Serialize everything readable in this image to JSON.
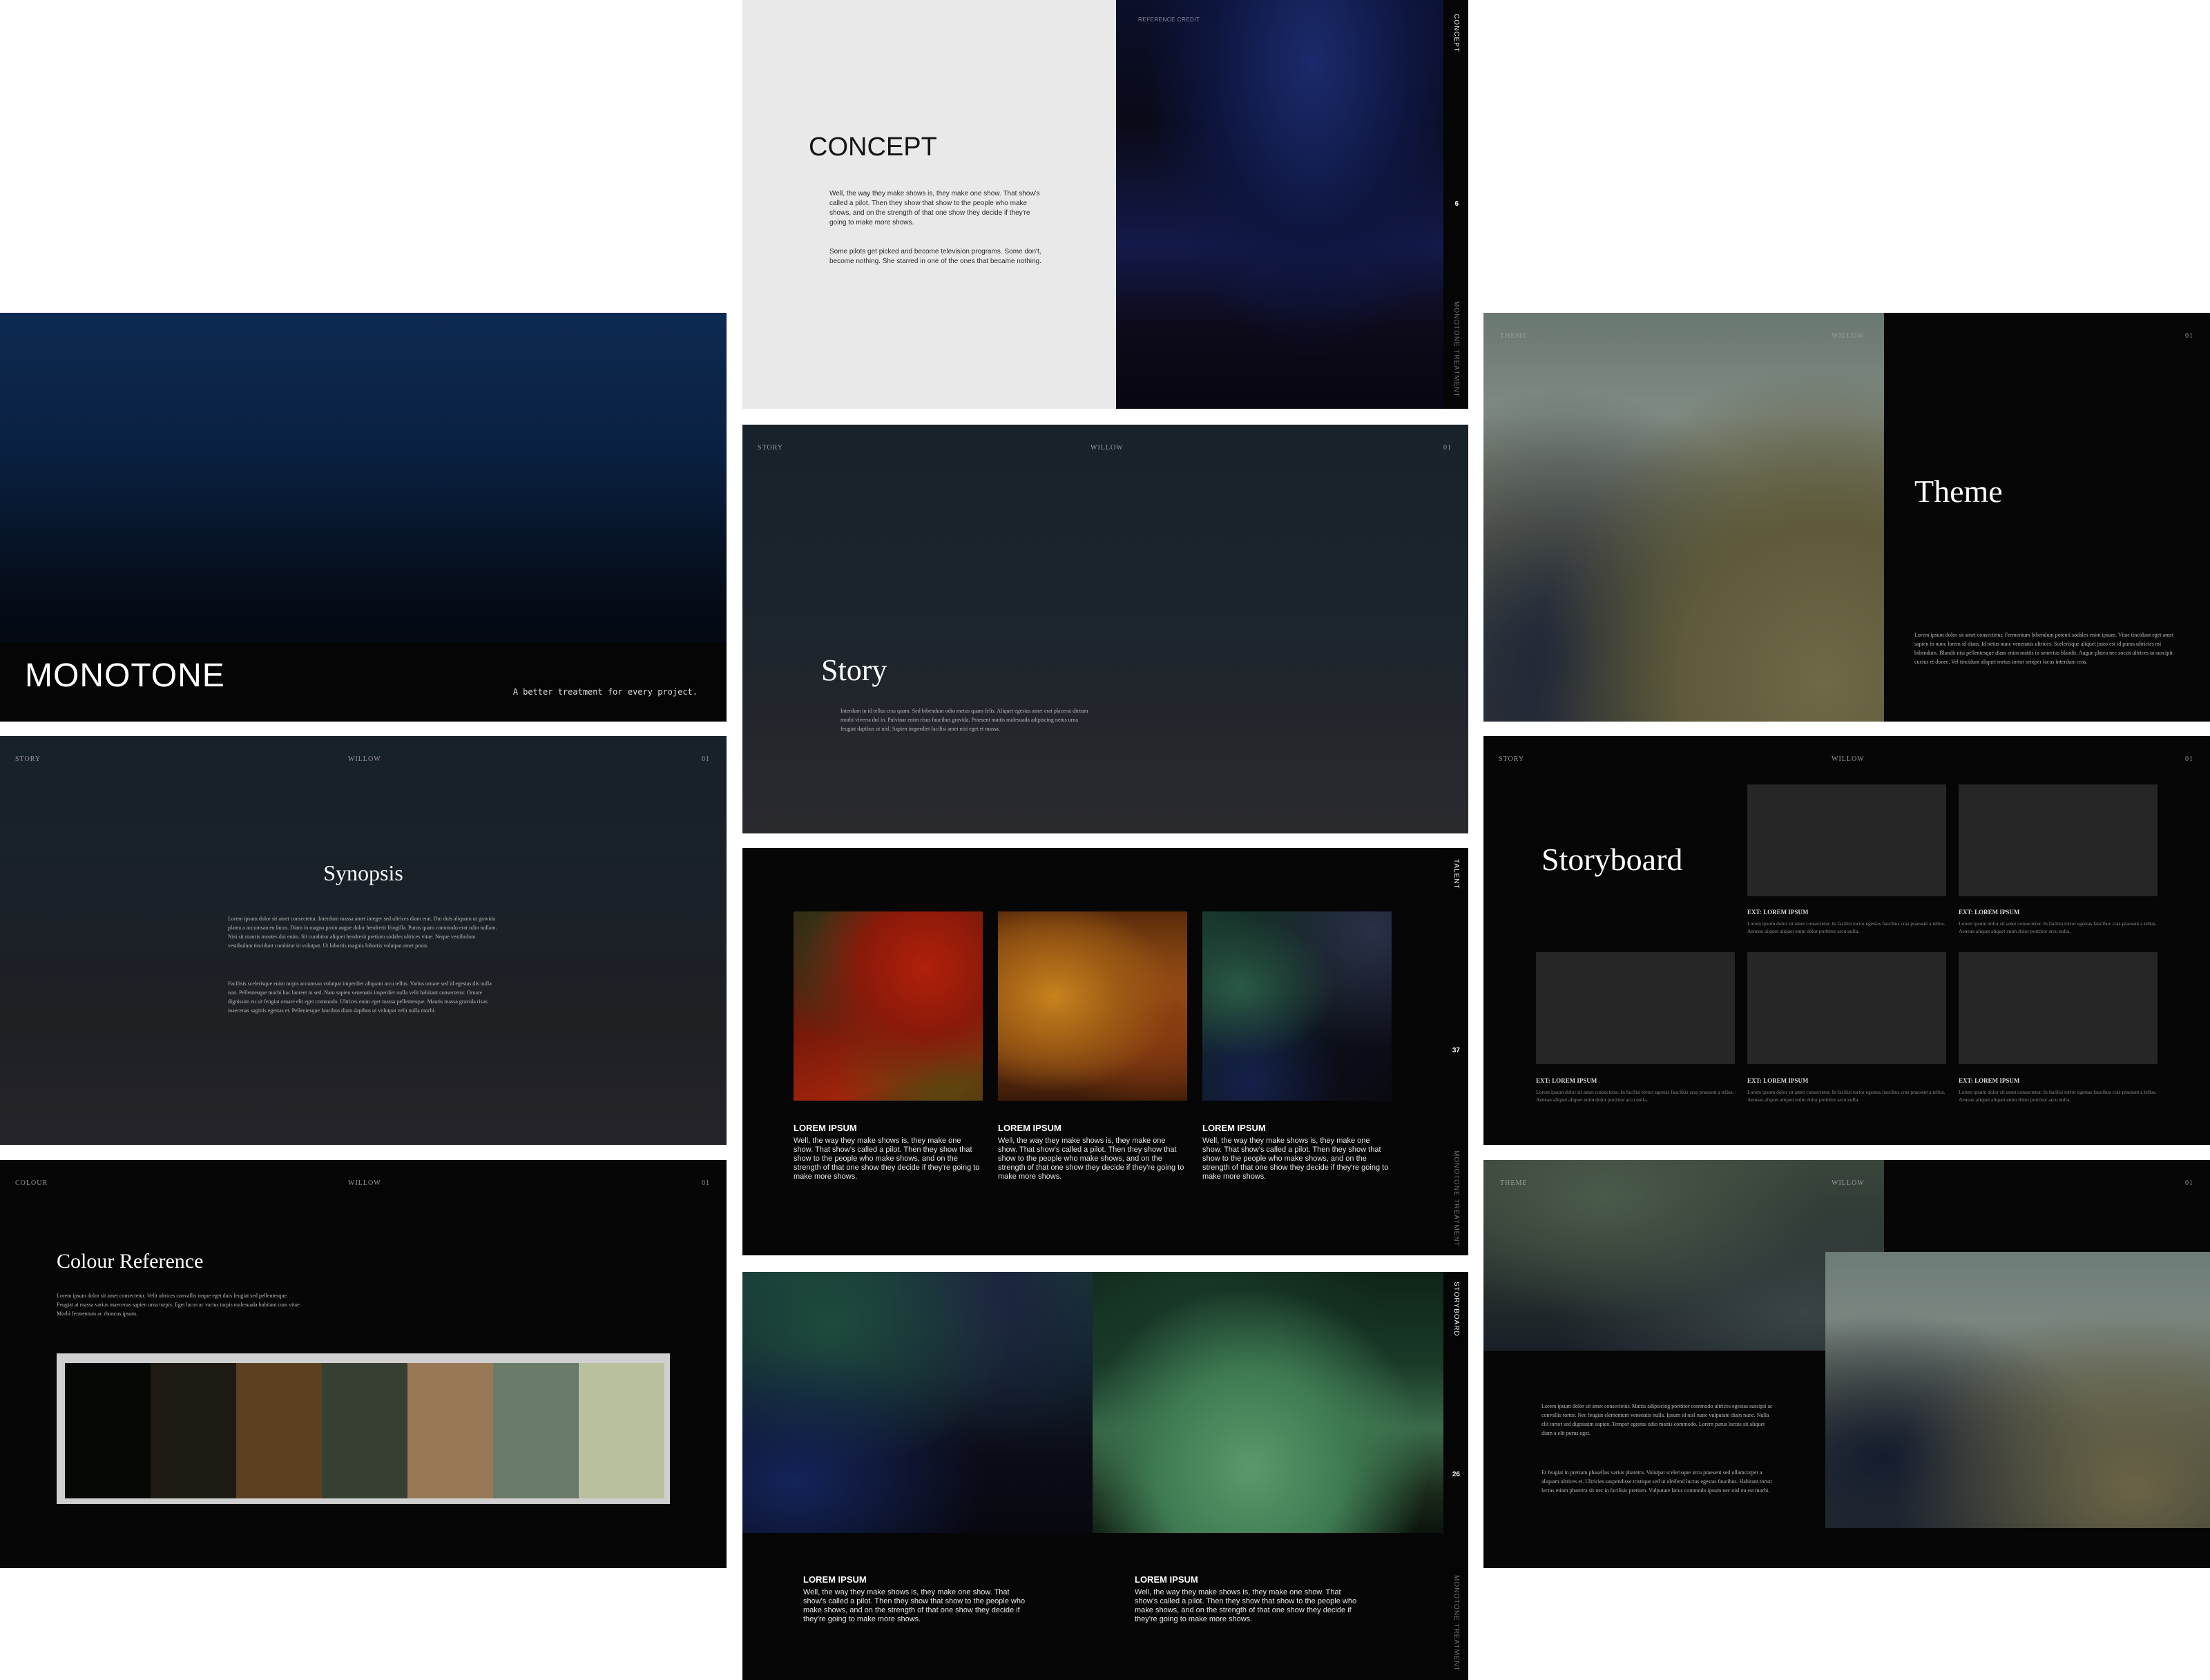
{
  "cover": {
    "title": "MONOTONE",
    "tagline": "A better treatment for every project."
  },
  "concept": {
    "title": "CONCEPT",
    "paragraph1": "Well, the way they make shows is, they make one show. That show's called a pilot. Then they show that show to the people who make shows, and on the strength of that one show they decide if they're going to make more shows.",
    "paragraph2": "Some pilots get picked and become television programs. Some don't, become nothing. She starred in one of the ones that became nothing.",
    "reference_credit": "REFERENCE CREDIT",
    "side_label": "CONCEPT",
    "page_number": "6",
    "side_footer": "MONOTONE TREATMENT"
  },
  "theme1": {
    "section": "THEME",
    "project": "WILLOW",
    "page": "01",
    "title": "Theme",
    "body": "Lorem ipsum dolor sit amet consectetur. Fermentum bibendum potenti sodales enim ipsum. Vitae tincidunt eget amet sapien in nunc lorem id diam. Id netus nunc venenatis ultrices. Scelerisque aliquet justo est id purus ultricies mi bibendum. Blandit nisi pellentesque diam enim mattis in senectus blandit. Augue platea nec sociis ultrices ut suscipit cursus et donec. Vel tincidunt aliquet metus tortor semper lacus interdum cras."
  },
  "story": {
    "section": "STORY",
    "project": "WILLOW",
    "page": "01",
    "title": "Story",
    "body": "Interdum in id tellus cras quam. Sed bibendum odio metus quam felis. Aliquet egestas amet erat placerat dictum morbi viverra dui in. Pulvinar enim risus faucibus gravida. Praesent mattis malesuada adipiscing netus urna feugiat dapibus ut nisl. Sapien imperdiet facilisi amet nisi eget et massa."
  },
  "synopsis": {
    "section": "STORY",
    "project": "WILLOW",
    "page": "01",
    "title": "Synopsis",
    "paragraph1": "Lorem ipsum dolor sit amet consectetur. Interdum massa amet integer sed ultrices diam erat. Dui duis aliquam ut gravida platea a accumsan eu lacus. Diam in magna proin augue dolor hendrerit fringilla. Purus quam commodo erat odio nullam. Nisi sit mauris montes dui enim. Sit curabitur aliquet hendrerit pretium sodales ultrices vitae. Neque vestibulum vestibulum tincidunt curabitur in volutpat. Ut lobortis magnis lobortis volutpat amet proin.",
    "paragraph2": "Facilisis scelerisque enim turpis accumsan volutpat imperdiet aliquam arcu tellus. Varius ornare sed id egestas dis nulla non. Pellentesque morbi hac laoreet in sed. Nam sapien venenatis imperdiet nulla velit habitant consectetur. Ornare dignissim eu sit feugiat ornare elit eget commodo. Ultrices enim eget massa pellentesque. Mauris massa gravida risus maecenas sagittis egestas et. Pellentesque faucibus diam dapibus ut volutpat velit nulla morbi."
  },
  "storyboard": {
    "section": "STORY",
    "project": "WILLOW",
    "page": "01",
    "title": "Storyboard",
    "frames": [
      {
        "caption": "EXT: LOREM IPSUM",
        "text": "Lorem ipsum dolor sit amet consectetur. In facilisi tortor egestas faucibus cras praesent a tellus. Aenean aliquet aliquet enim dolor porttitor arcu nulla."
      },
      {
        "caption": "EXT: LOREM IPSUM",
        "text": "Lorem ipsum dolor sit amet consectetur. In facilisi tortor egestas faucibus cras praesent a tellus. Aenean aliquet aliquet enim dolor porttitor arcu nulla."
      },
      {
        "caption": "EXT: LOREM IPSUM",
        "text": "Lorem ipsum dolor sit amet consectetur. In facilisi tortor egestas faucibus cras praesent a tellus. Aenean aliquet aliquet enim dolor porttitor arcu nulla."
      },
      {
        "caption": "EXT: LOREM IPSUM",
        "text": "Lorem ipsum dolor sit amet consectetur. In facilisi tortor egestas faucibus cras praesent a tellus. Aenean aliquet aliquet enim dolor porttitor arcu nulla."
      },
      {
        "caption": "EXT: LOREM IPSUM",
        "text": "Lorem ipsum dolor sit amet consectetur. In facilisi tortor egestas faucibus cras praesent a tellus. Aenean aliquet aliquet enim dolor porttitor arcu nulla."
      }
    ]
  },
  "talent": {
    "side_label": "TALENT",
    "page_number": "37",
    "side_footer": "MONOTONE TREATMENT",
    "cards": [
      {
        "title": "LOREM IPSUM",
        "text": "Well, the way they make shows is, they make one show. That show's called a pilot. Then they show that show to the people who make shows, and on the strength of that one show they decide if they're going to make more shows."
      },
      {
        "title": "LOREM IPSUM",
        "text": "Well, the way they make shows is, they make one show. That show's called a pilot. Then they show that show to the people who make shows, and on the strength of that one show they decide if they're going to make more shows."
      },
      {
        "title": "LOREM IPSUM",
        "text": "Well, the way they make shows is, they make one show. That show's called a pilot. Then they show that show to the people who make shows, and on the strength of that one show they decide if they're going to make more shows."
      }
    ]
  },
  "colour": {
    "section": "COLOUR",
    "project": "WILLOW",
    "page": "01",
    "title": "Colour Reference",
    "body": "Lorem ipsum dolor sit amet consectetur. Velit ultrices convallis neque eget duis feugiat sed pellentesque. Feugiat at massa varius maecenas sapien urna turpis. Eget lacus ac varius turpis malesuada habitant cum vitae. Morbi fermentum ac rhoncus ipsum.",
    "swatches": [
      "#050805",
      "#1e1a14",
      "#5b4021",
      "#363f32",
      "#997855",
      "#6a7a69",
      "#b8c09e"
    ]
  },
  "storyboard2": {
    "side_label": "STORYBOARD",
    "page_number": "26",
    "side_footer": "MONOTONE TREATMENT",
    "cards": [
      {
        "title": "LOREM IPSUM",
        "text": "Well, the way they make shows is, they make one show. That show's called a pilot. Then they show that show to the people who make shows, and on the strength of that one show they decide if they're going to make more shows."
      },
      {
        "title": "LOREM IPSUM",
        "text": "Well, the way they make shows is, they make one show. That show's called a pilot. Then they show that show to the people who make shows, and on the strength of that one show they decide if they're going to make more shows."
      }
    ]
  },
  "theme2": {
    "section": "THEME",
    "project": "WILLOW",
    "page": "01",
    "paragraph1": "Lorem ipsum dolor sit amet consectetur. Mattis adipiscing porttitor commodo ultrices egestas suscipit ac convallis tortor. Nec feugiat elementum venenatis nulla. Ipsum id nisl nunc vulputate diam nunc. Nulla elit tortor sed dignissim sapien. Tempor egestas odio mattis commodo. Lorem purus luctus sit aliquet diam a elit purus eget.",
    "paragraph2": "Et feugiat in pretium phasellus varius pharetra. Volutpat scelerisque arcu praesent sed ullamcorper a aliquam ultrices et. Ultricies suspendisse tristique sed ut eleifend luctus egestas faucibus. Habitant tortor lectus etiam pharetra sit nec in facilisis pretium. Vulputate lacus commodo ipsum nec nisl eu est morbi."
  }
}
